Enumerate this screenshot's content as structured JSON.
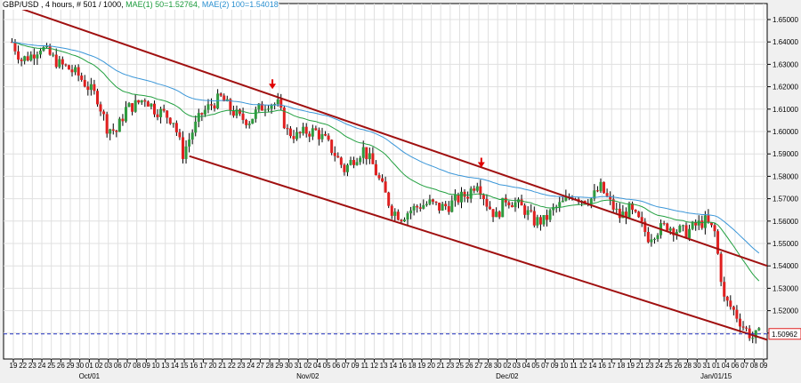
{
  "header": {
    "symbol": "GBP/USD , 4 hours, # 501 / 1000,",
    "ma1": "MAE(1) 50=1.52764,",
    "ma2": "MAE(2) 100=1.54018"
  },
  "colors": {
    "up": "#2e9a3e",
    "down": "#e02020",
    "ma1": "#22a040",
    "ma2": "#3a96d8",
    "channel": "#a01010",
    "current": "#2030c0"
  },
  "chart_data": {
    "type": "candlestick",
    "title": "GBP/USD , 4 hours",
    "ylim": [
      1.5,
      1.655
    ],
    "yticks": [
      "1.65000",
      "1.64000",
      "1.63000",
      "1.62000",
      "1.61000",
      "1.60000",
      "1.59000",
      "1.58000",
      "1.57000",
      "1.56000",
      "1.55000",
      "1.54000",
      "1.53000",
      "1.52000",
      "1.51000"
    ],
    "current_price": "1.50962",
    "xticks": [
      "19",
      "22",
      "23",
      "24",
      "25",
      "26",
      "29",
      "30",
      "01",
      "02",
      "03",
      "06",
      "07",
      "08",
      "09",
      "10",
      "13",
      "14",
      "15",
      "16",
      "17",
      "20",
      "21",
      "22",
      "23",
      "24",
      "27",
      "28",
      "29",
      "30",
      "31",
      "02",
      "04",
      "05",
      "06",
      "07",
      "09",
      "11",
      "12",
      "13",
      "14",
      "16",
      "18",
      "19",
      "20",
      "21",
      "23",
      "25",
      "26",
      "27",
      "28",
      "30",
      "02",
      "03",
      "04",
      "05",
      "07",
      "09",
      "10",
      "11",
      "12",
      "14",
      "16",
      "17",
      "18",
      "19",
      "21",
      "23",
      "24",
      "25",
      "26",
      "28",
      "30",
      "31",
      "01",
      "04",
      "06",
      "07",
      "08",
      "09"
    ],
    "month_labels": [
      {
        "label": "Oct/01",
        "index": 8
      },
      {
        "label": "Nov/02",
        "index": 31
      },
      {
        "label": "Dec/02",
        "index": 52
      },
      {
        "label": "Jan/01/15",
        "index": 74
      }
    ],
    "closes": [
      1.64,
      1.632,
      1.634,
      1.638,
      1.634,
      1.63,
      1.628,
      1.625,
      1.62,
      1.615,
      1.602,
      1.6,
      1.61,
      1.612,
      1.615,
      1.61,
      1.608,
      1.605,
      1.59,
      1.6,
      1.608,
      1.612,
      1.615,
      1.61,
      1.606,
      1.605,
      1.61,
      1.613,
      1.612,
      1.6,
      1.598,
      1.6,
      1.6,
      1.596,
      1.59,
      1.583,
      1.588,
      1.592,
      1.585,
      1.575,
      1.565,
      1.562,
      1.565,
      1.567,
      1.568,
      1.566,
      1.567,
      1.57,
      1.572,
      1.578,
      1.568,
      1.562,
      1.57,
      1.568,
      1.565,
      1.56,
      1.56,
      1.565,
      1.568,
      1.572,
      1.57,
      1.57,
      1.575,
      1.568,
      1.562,
      1.565,
      1.56,
      1.553,
      1.556,
      1.558,
      1.556,
      1.555,
      1.558,
      1.56,
      1.555,
      1.525,
      1.52,
      1.513,
      1.508,
      1.51
    ],
    "series": [
      {
        "name": "MAE(1) 50",
        "last": 1.52764
      },
      {
        "name": "MAE(2) 100",
        "last": 1.54018
      }
    ],
    "channel": {
      "upper": [
        [
          0,
          1.657
        ],
        [
          80,
          1.54
        ]
      ],
      "lower": [
        [
          19,
          1.589
        ],
        [
          80,
          1.507
        ]
      ]
    },
    "arrows": [
      27,
      49
    ]
  }
}
